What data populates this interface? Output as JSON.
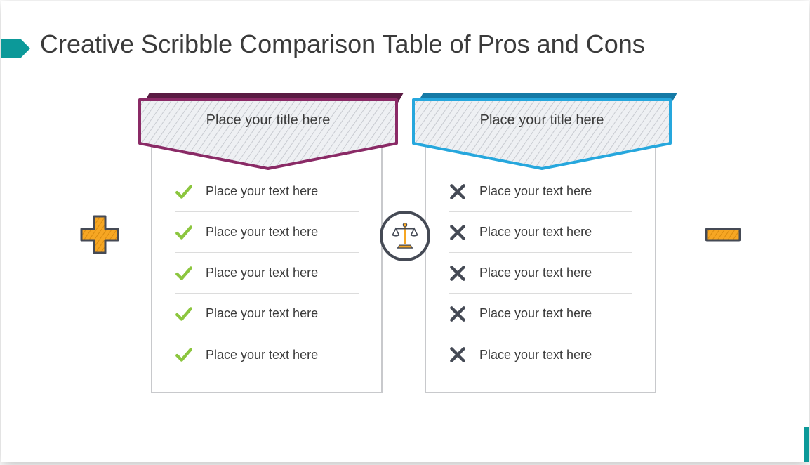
{
  "title": "Creative Scribble Comparison Table of Pros and Cons",
  "colors": {
    "accent": "#0c9999",
    "pros_border": "#8a2a66",
    "cons_border": "#26a7dd",
    "check": "#8cc63f",
    "cross": "#454a55",
    "badge": "#f6a623"
  },
  "icons": {
    "plus": "plus-icon",
    "minus": "minus-icon",
    "scale": "scale-icon",
    "check": "check-icon",
    "cross": "cross-icon"
  },
  "pros": {
    "title": "Place your title here",
    "items": [
      "Place your text here",
      "Place your text here",
      "Place your text here",
      "Place your text here",
      "Place your text here"
    ]
  },
  "cons": {
    "title": "Place your title here",
    "items": [
      "Place your text here",
      "Place your text here",
      "Place your text here",
      "Place your text here",
      "Place your text here"
    ]
  }
}
